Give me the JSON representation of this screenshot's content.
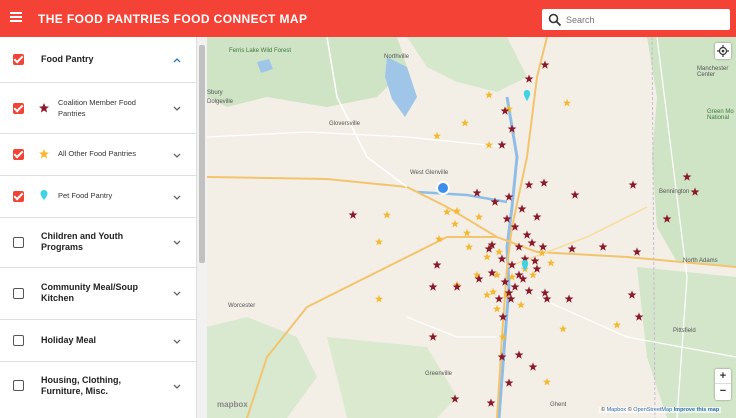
{
  "header": {
    "title": "THE FOOD PANTRIES FOOD CONNECT MAP",
    "search_placeholder": "Search",
    "menu_icon": "hamburger-menu-icon",
    "search_icon": "search-icon"
  },
  "colors": {
    "accent": "#f44336",
    "coalition_star": "#8b1a2b",
    "other_star": "#f5b82e",
    "pet_marker": "#3fd3e3",
    "user_location": "#3b8fe6"
  },
  "sidebar": {
    "items": [
      {
        "label": "Food Pantry",
        "checked": true,
        "expanded": true,
        "icon": "chevron-up-icon"
      },
      {
        "label": "Coalition Member Food Pantries",
        "checked": true,
        "legend_icon": "star-icon"
      },
      {
        "label": "All Other Food Pantries",
        "checked": true,
        "legend_icon": "star-icon"
      },
      {
        "label": "Pet Food Pantry",
        "checked": true,
        "legend_icon": "pin-icon"
      },
      {
        "label": "Children and Youth Programs",
        "checked": false
      },
      {
        "label": "Community Meal/Soup Kitchen",
        "checked": false
      },
      {
        "label": "Holiday Meal",
        "checked": false
      },
      {
        "label": "Housing, Clothing, Furniture, Misc.",
        "checked": false
      }
    ]
  },
  "map": {
    "place_labels": [
      "Ferris Lake Wild Forest",
      "Northville",
      "Gloversville",
      "West Glenville",
      "Worcester",
      "Greenville",
      "Ghent",
      "Bennington",
      "North Adams",
      "Pittsfield",
      "Manchester Center",
      "Dolgeville",
      "Sbury",
      "Green Mo National"
    ],
    "zoom_in": "+",
    "zoom_out": "−",
    "logo": "mapbox",
    "attribution": {
      "copyright": "©",
      "mapbox": "Mapbox",
      "osm": "OpenStreetMap",
      "improve": "Improve this map"
    }
  }
}
